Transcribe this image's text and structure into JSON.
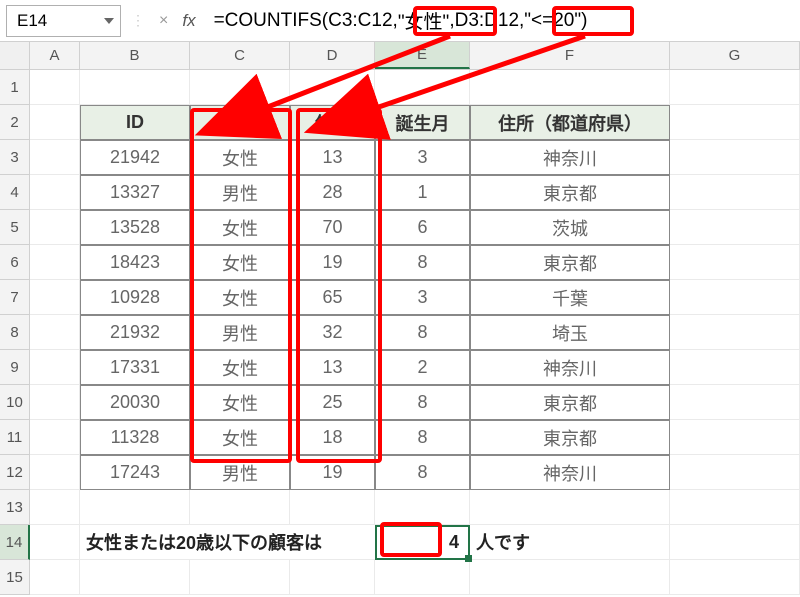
{
  "name_box": "E14",
  "formula": {
    "prefix": "=COUNTIFS(",
    "range1": "C3:C12",
    "sep1": ",",
    "crit1": "\"女性\"",
    "sep2": ",",
    "range2": "D3:D12",
    "sep3": ",",
    "crit2": "\"<=20\")"
  },
  "columns": [
    "A",
    "B",
    "C",
    "D",
    "E",
    "F",
    "G"
  ],
  "rows": [
    "1",
    "2",
    "3",
    "4",
    "5",
    "6",
    "7",
    "8",
    "9",
    "10",
    "11",
    "12",
    "13",
    "14",
    "15"
  ],
  "headers": {
    "b": "ID",
    "c": "性別",
    "d": "年齢",
    "e": "誕生月",
    "f": "住所（都道府県）"
  },
  "tdata": [
    {
      "b": "21942",
      "c": "女性",
      "d": "13",
      "e": "3",
      "f": "神奈川"
    },
    {
      "b": "13327",
      "c": "男性",
      "d": "28",
      "e": "1",
      "f": "東京都"
    },
    {
      "b": "13528",
      "c": "女性",
      "d": "70",
      "e": "6",
      "f": "茨城"
    },
    {
      "b": "18423",
      "c": "女性",
      "d": "19",
      "e": "8",
      "f": "東京都"
    },
    {
      "b": "10928",
      "c": "女性",
      "d": "65",
      "e": "3",
      "f": "千葉"
    },
    {
      "b": "21932",
      "c": "男性",
      "d": "32",
      "e": "8",
      "f": "埼玉"
    },
    {
      "b": "17331",
      "c": "女性",
      "d": "13",
      "e": "2",
      "f": "神奈川"
    },
    {
      "b": "20030",
      "c": "女性",
      "d": "25",
      "e": "8",
      "f": "東京都"
    },
    {
      "b": "11328",
      "c": "女性",
      "d": "18",
      "e": "8",
      "f": "東京都"
    },
    {
      "b": "17243",
      "c": "男性",
      "d": "19",
      "e": "8",
      "f": "神奈川"
    }
  ],
  "result_row": {
    "label_pre": "女性または20歳以下の顧客は",
    "value": "4",
    "label_post": "人です"
  }
}
